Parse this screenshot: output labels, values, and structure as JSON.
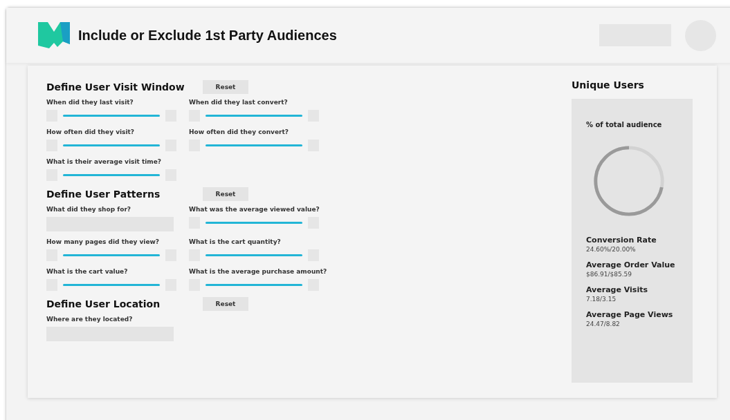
{
  "header": {
    "title": "Include or Exclude 1st Party Audiences"
  },
  "sections": [
    {
      "title": "Define User Visit Window",
      "reset": "Reset",
      "items": [
        {
          "kind": "slider",
          "label": "When did they last visit?"
        },
        {
          "kind": "slider",
          "label": "When did they last convert?"
        },
        {
          "kind": "slider",
          "label": "How often did they visit?"
        },
        {
          "kind": "slider",
          "label": "How often did they convert?"
        },
        {
          "kind": "slider",
          "label": "What is their average visit time?"
        }
      ]
    },
    {
      "title": "Define User Patterns",
      "reset": "Reset",
      "items": [
        {
          "kind": "field",
          "label": "What did they shop for?"
        },
        {
          "kind": "slider",
          "label": "What was the average viewed value?"
        },
        {
          "kind": "slider",
          "label": "How many pages did they view?"
        },
        {
          "kind": "slider",
          "label": "What is the cart quantity?"
        },
        {
          "kind": "slider",
          "label": "What is the cart value?"
        },
        {
          "kind": "slider",
          "label": "What is the average purchase amount?"
        }
      ]
    },
    {
      "title": "Define User Location",
      "reset": "Reset",
      "items": [
        {
          "kind": "field",
          "label": "Where are they located?"
        }
      ]
    }
  ],
  "summary": {
    "title": "Unique Users",
    "gauge_label": "% of total audience",
    "gauge": {
      "level": 0.72
    },
    "stats": [
      {
        "label": "Conversion Rate",
        "value": "24.60%/20.00%"
      },
      {
        "label": "Average Order Value",
        "value": "$86.91/$85.59"
      },
      {
        "label": "Average Visits",
        "value": "7.18/3.15"
      },
      {
        "label": "Average Page Views",
        "value": "24.47/8.82"
      }
    ]
  }
}
